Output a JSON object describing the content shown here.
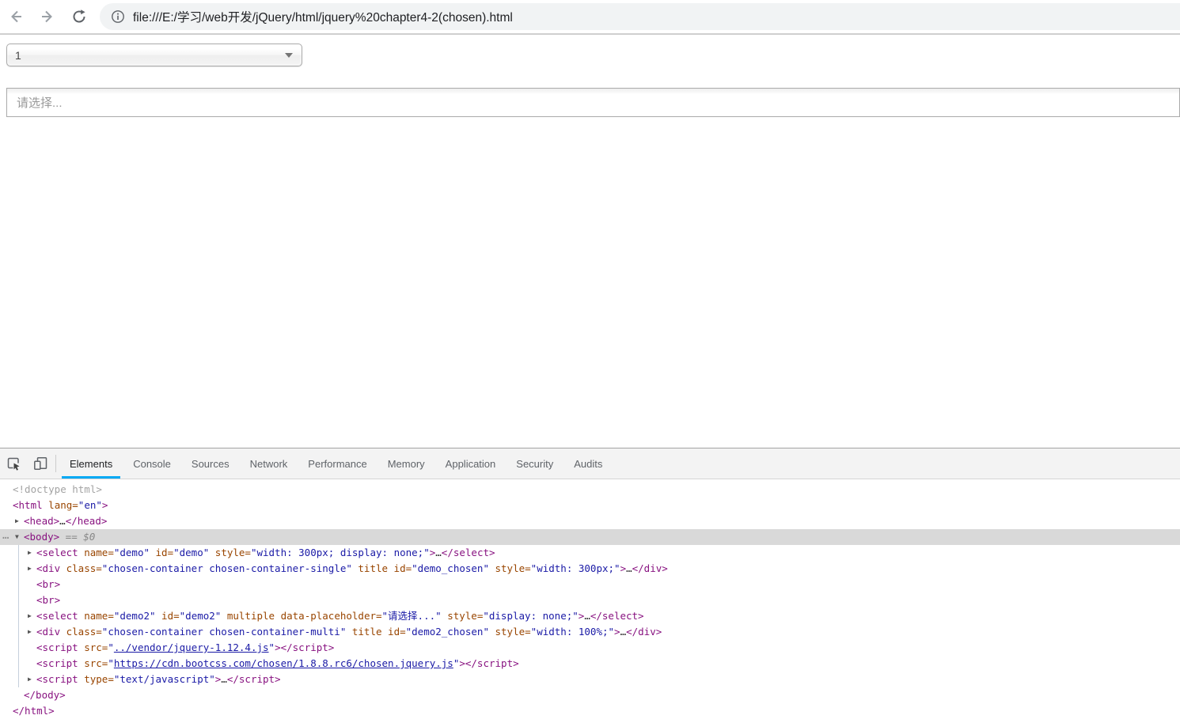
{
  "browser": {
    "url": "file:///E:/学习/web开发/jQuery/html/jquery%20chapter4-2(chosen).html"
  },
  "page": {
    "single_select": {
      "value": "1"
    },
    "multi_select": {
      "placeholder": "请选择..."
    }
  },
  "devtools": {
    "tabs": [
      {
        "label": "Elements",
        "active": true
      },
      {
        "label": "Console",
        "active": false
      },
      {
        "label": "Sources",
        "active": false
      },
      {
        "label": "Network",
        "active": false
      },
      {
        "label": "Performance",
        "active": false
      },
      {
        "label": "Memory",
        "active": false
      },
      {
        "label": "Application",
        "active": false
      },
      {
        "label": "Security",
        "active": false
      },
      {
        "label": "Audits",
        "active": false
      }
    ],
    "selected_node_hint": "== $0",
    "tree": [
      {
        "i": 0,
        "seg": [
          [
            "gray",
            "<!doctype html>"
          ]
        ]
      },
      {
        "i": 0,
        "seg": [
          [
            "tag",
            "<html"
          ],
          [
            "attr",
            " lang="
          ],
          [
            "val",
            "\"en\""
          ],
          [
            "tag",
            ">"
          ]
        ]
      },
      {
        "i": 1,
        "a": "r",
        "seg": [
          [
            "tag",
            "<head>"
          ],
          [
            "ell",
            "…"
          ],
          [
            "tag",
            "</head>"
          ]
        ]
      },
      {
        "i": 1,
        "a": "d",
        "sel": true,
        "dots": true,
        "seg": [
          [
            "tag",
            "<body>"
          ],
          [
            "eq",
            " == $0"
          ]
        ]
      },
      {
        "i": 2,
        "a": "r",
        "seg": [
          [
            "tag",
            "<select"
          ],
          [
            "attr",
            " name="
          ],
          [
            "val",
            "\"demo\""
          ],
          [
            "attr",
            " id="
          ],
          [
            "val",
            "\"demo\""
          ],
          [
            "attr",
            " style="
          ],
          [
            "val",
            "\"width: 300px; display: none;\""
          ],
          [
            "tag",
            ">"
          ],
          [
            "ell",
            "…"
          ],
          [
            "tag",
            "</select>"
          ]
        ]
      },
      {
        "i": 2,
        "a": "r",
        "seg": [
          [
            "tag",
            "<div"
          ],
          [
            "attr",
            " class="
          ],
          [
            "val",
            "\"chosen-container chosen-container-single\""
          ],
          [
            "attr",
            " title"
          ],
          [
            "attr",
            " id="
          ],
          [
            "val",
            "\"demo_chosen\""
          ],
          [
            "attr",
            " style="
          ],
          [
            "val",
            "\"width: 300px;\""
          ],
          [
            "tag",
            ">"
          ],
          [
            "ell",
            "…"
          ],
          [
            "tag",
            "</div>"
          ]
        ]
      },
      {
        "i": 2,
        "seg": [
          [
            "tag",
            "<br>"
          ]
        ]
      },
      {
        "i": 2,
        "seg": [
          [
            "tag",
            "<br>"
          ]
        ]
      },
      {
        "i": 2,
        "a": "r",
        "seg": [
          [
            "tag",
            "<select"
          ],
          [
            "attr",
            " name="
          ],
          [
            "val",
            "\"demo2\""
          ],
          [
            "attr",
            " id="
          ],
          [
            "val",
            "\"demo2\""
          ],
          [
            "attr",
            " multiple"
          ],
          [
            "attr",
            " data-placeholder="
          ],
          [
            "val",
            "\"请选择...\""
          ],
          [
            "attr",
            " style="
          ],
          [
            "val",
            "\"display: none;\""
          ],
          [
            "tag",
            ">"
          ],
          [
            "ell",
            "…"
          ],
          [
            "tag",
            "</select>"
          ]
        ]
      },
      {
        "i": 2,
        "a": "r",
        "seg": [
          [
            "tag",
            "<div"
          ],
          [
            "attr",
            " class="
          ],
          [
            "val",
            "\"chosen-container chosen-container-multi\""
          ],
          [
            "attr",
            " title"
          ],
          [
            "attr",
            " id="
          ],
          [
            "val",
            "\"demo2_chosen\""
          ],
          [
            "attr",
            " style="
          ],
          [
            "val",
            "\"width: 100%;\""
          ],
          [
            "tag",
            ">"
          ],
          [
            "ell",
            "…"
          ],
          [
            "tag",
            "</div>"
          ]
        ]
      },
      {
        "i": 2,
        "seg": [
          [
            "tag",
            "<script"
          ],
          [
            "attr",
            " src="
          ],
          [
            "val",
            "\""
          ],
          [
            "link",
            "../vendor/jquery-1.12.4.js"
          ],
          [
            "val",
            "\""
          ],
          [
            "tag",
            "></script>"
          ]
        ]
      },
      {
        "i": 2,
        "seg": [
          [
            "tag",
            "<script"
          ],
          [
            "attr",
            " src="
          ],
          [
            "val",
            "\""
          ],
          [
            "link",
            "https://cdn.bootcss.com/chosen/1.8.8.rc6/chosen.jquery.js"
          ],
          [
            "val",
            "\""
          ],
          [
            "tag",
            "></script>"
          ]
        ]
      },
      {
        "i": 2,
        "a": "r",
        "seg": [
          [
            "tag",
            "<script"
          ],
          [
            "attr",
            " type="
          ],
          [
            "val",
            "\"text/javascript\""
          ],
          [
            "tag",
            ">"
          ],
          [
            "ell",
            "…"
          ],
          [
            "tag",
            "</script>"
          ]
        ]
      },
      {
        "i": 1,
        "seg": [
          [
            "tag",
            "</body>"
          ]
        ]
      },
      {
        "i": 0,
        "seg": [
          [
            "tag",
            "</html>"
          ]
        ]
      }
    ]
  },
  "icons": {
    "back": "arrow-left",
    "forward": "arrow-right",
    "reload": "circular-arrow",
    "info": "info-circle",
    "inspect": "cursor-in-box",
    "device": "phone-and-tablet",
    "single_arrow": "dropdown-triangle"
  },
  "colors": {
    "accent_underline": "#03a9f4",
    "syntax_tag": "#881280",
    "syntax_attr": "#994500",
    "syntax_value": "#1a1aa6",
    "selection_bg": "#d9d9d9",
    "omnibox_bg": "#f1f3f4",
    "toolbar_bg": "#f3f3f3"
  }
}
